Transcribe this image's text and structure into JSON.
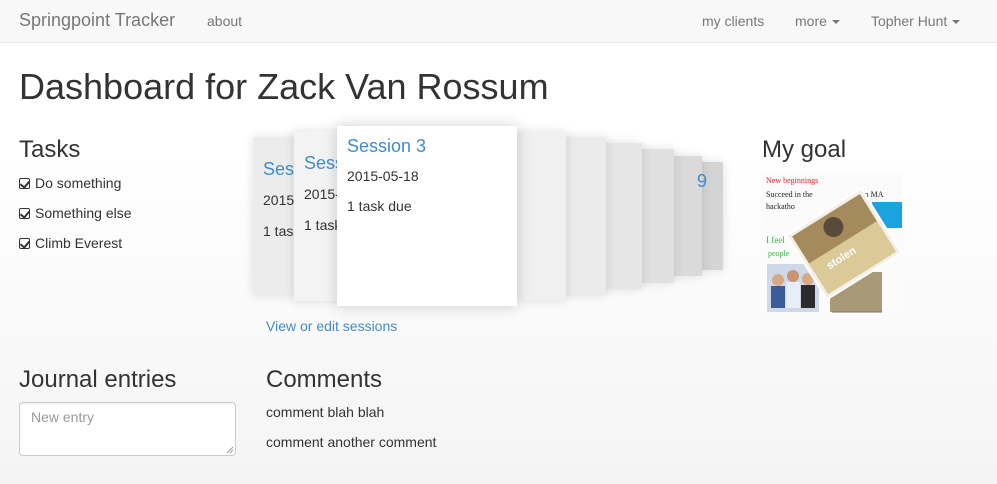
{
  "navbar": {
    "brand": "Springpoint Tracker",
    "about": "about",
    "my_clients": "my clients",
    "more": "more",
    "user": "Topher Hunt"
  },
  "page": {
    "title": "Dashboard for Zack Van Rossum"
  },
  "tasks": {
    "heading": "Tasks",
    "items": [
      "Do something",
      "Something else",
      "Climb Everest"
    ]
  },
  "sessions": {
    "cards": [
      {
        "title": "Sess",
        "date": "2015",
        "due": "1 task"
      },
      {
        "title": "Sess",
        "date": "2015-",
        "due": "1 task"
      },
      {
        "title": "Session 3",
        "date": "2015-05-18",
        "due": "1 task due"
      }
    ],
    "back_glyph": "9",
    "view_link": "View or edit sessions"
  },
  "goal": {
    "heading": "My goal",
    "collage_text": [
      "New beginnings",
      "Succeed in the",
      "rn MA",
      "hackatho",
      "I feel",
      "people"
    ],
    "sign_text": "stolen"
  },
  "journal": {
    "heading": "Journal entries",
    "placeholder": "New entry"
  },
  "comments": {
    "heading": "Comments",
    "items": [
      "comment blah blah",
      "comment another comment"
    ]
  },
  "colors": {
    "link": "#428bca",
    "navbar_bg": "#f8f8f8",
    "text": "#333333"
  }
}
